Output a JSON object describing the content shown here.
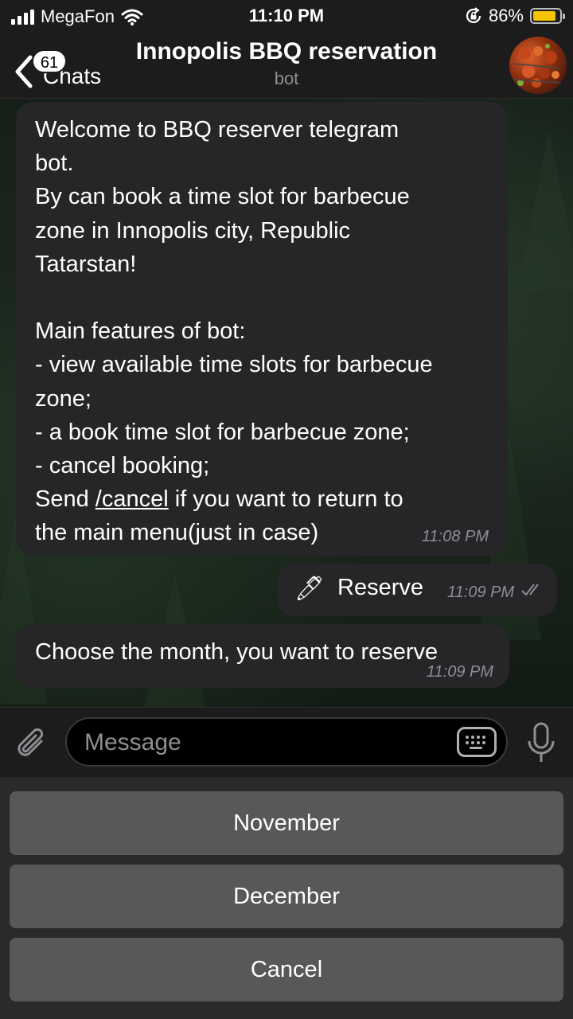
{
  "status_bar": {
    "carrier": "MegaFon",
    "time": "11:10 PM",
    "battery_percent": "86%",
    "battery_level": 0.86,
    "signal_bars": 4,
    "icons": [
      "signal-icon",
      "wifi-icon",
      "orientation-lock-icon",
      "battery-icon"
    ]
  },
  "nav": {
    "back_label": "Chats",
    "unread_badge": "61",
    "title": "Innopolis BBQ reservation",
    "subtitle": "bot",
    "avatar_icon": "bbq-avatar"
  },
  "messages": [
    {
      "direction": "incoming",
      "text_before": "Welcome to BBQ reserver telegram\nbot.\nBy can book a time slot for barbecue\nzone in Innopolis city, Republic\nTatarstan!\n\nMain features of bot:\n- view available time slots for barbecue\nzone;\n- a book time slot for barbecue zone;\n- cancel booking;\nSend ",
      "command": "/cancel",
      "text_after": " if you want to return to\nthe main menu(just in case)",
      "time": "11:08 PM"
    },
    {
      "direction": "outgoing",
      "emoji": "🖊",
      "text": "Reserve",
      "time": "11:09 PM",
      "status": "read"
    },
    {
      "direction": "incoming",
      "text": "Choose the month, you want to reserve",
      "time": "11:09 PM"
    }
  ],
  "input": {
    "placeholder": "Message",
    "value": ""
  },
  "keyboard": {
    "buttons": [
      "November",
      "December",
      "Cancel"
    ]
  }
}
